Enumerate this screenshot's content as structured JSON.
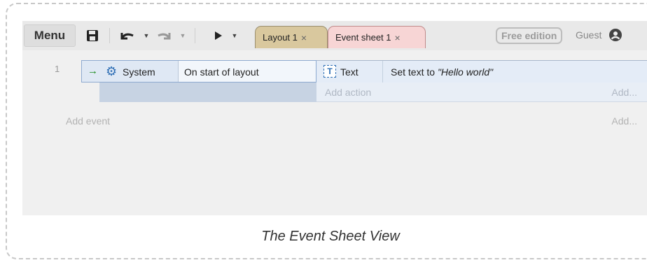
{
  "toolbar": {
    "menu_label": "Menu",
    "tabs": [
      {
        "label": "Layout 1",
        "close": "×"
      },
      {
        "label": "Event sheet 1",
        "close": "×"
      }
    ],
    "edition_badge": "Free edition",
    "user_label": "Guest"
  },
  "event_sheet": {
    "events": [
      {
        "number": "1",
        "condition": {
          "object": "System",
          "text": "On start of layout"
        },
        "action": {
          "object": "Text",
          "text_prefix": "Set text to ",
          "text_value": "\"Hello world\""
        }
      }
    ],
    "add_action_label": "Add action",
    "add_right_label": "Add...",
    "add_event_label": "Add event",
    "add_right_label_2": "Add..."
  },
  "caption": "The Event Sheet View",
  "colors": {
    "layout_tab": "#d9c89e",
    "event_tab": "#f7d5d5",
    "condition_arrow": "#1a8a1a",
    "system_gear": "#2f6fb5"
  },
  "icons": [
    "save-icon",
    "undo-icon",
    "redo-icon",
    "play-icon",
    "user-circle-icon",
    "arrow-right-icon",
    "gear-icon",
    "text-object-icon"
  ]
}
